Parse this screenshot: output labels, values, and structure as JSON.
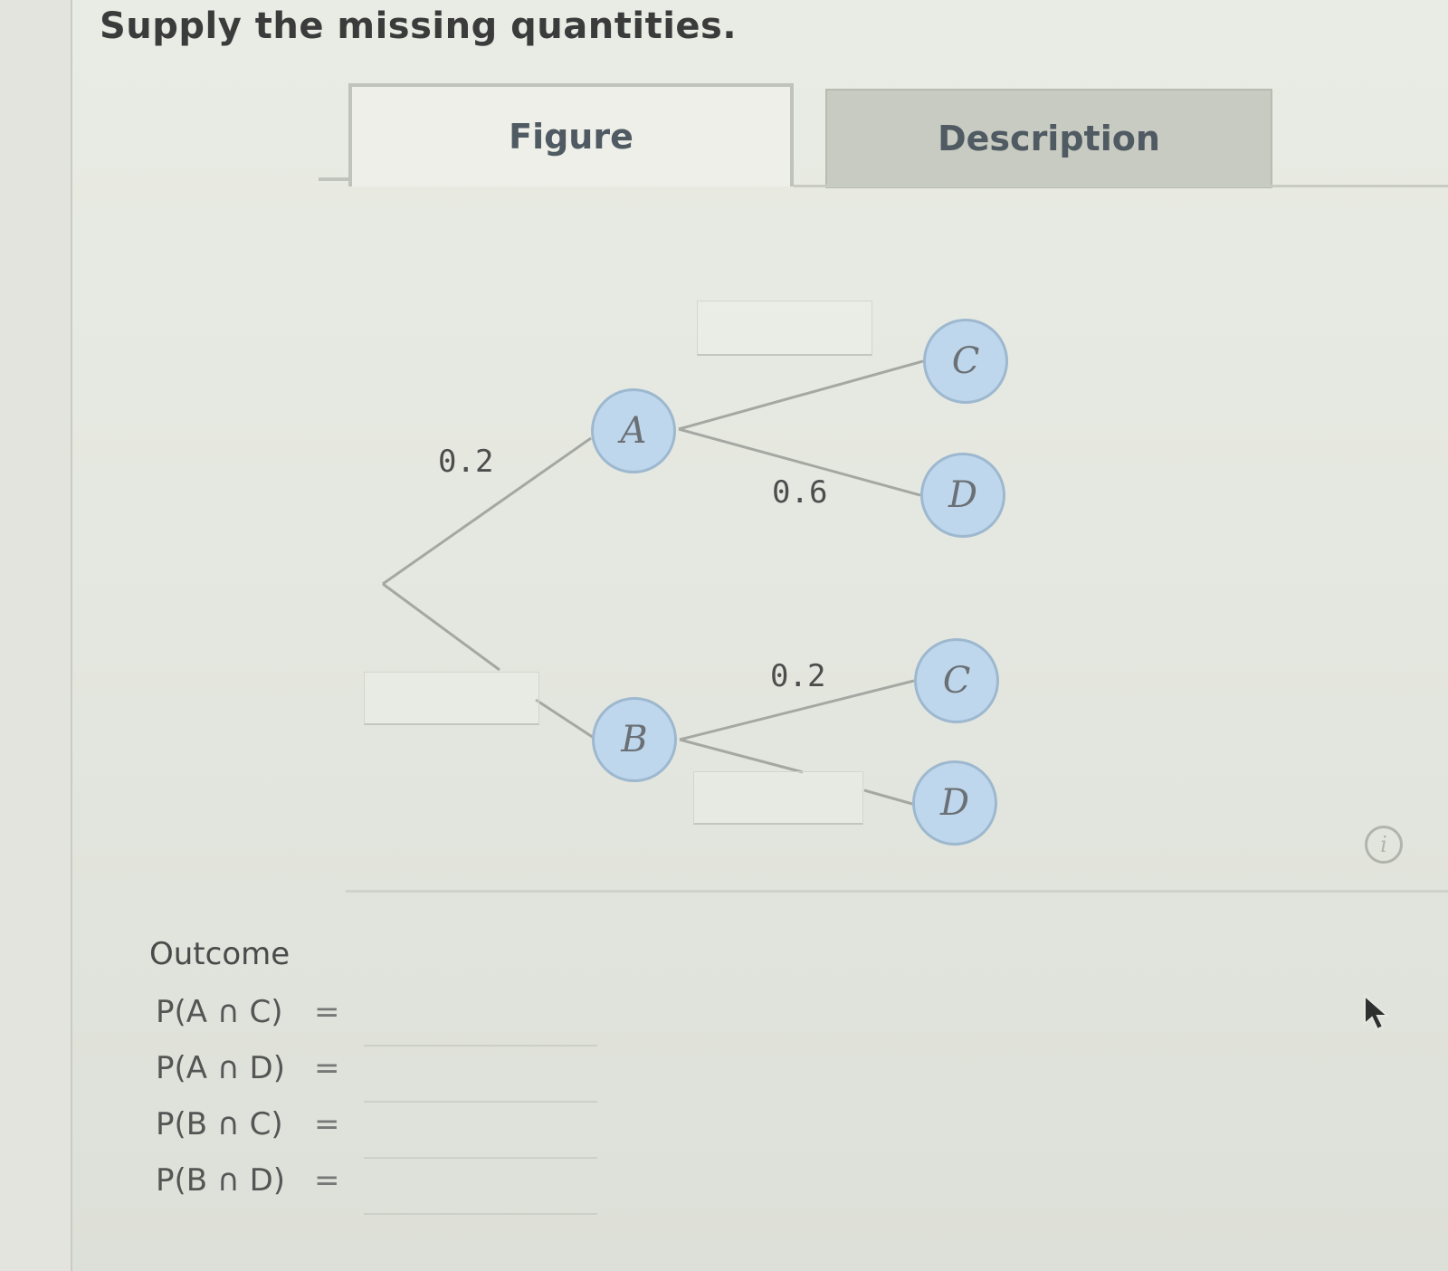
{
  "title": "Supply the missing quantities.",
  "tabs": [
    {
      "label": "Figure",
      "active": true
    },
    {
      "label": "Description",
      "active": false
    }
  ],
  "tree": {
    "branch_probabilities": {
      "A": "0.2",
      "A_D": "0.6",
      "B_C": "0.2"
    },
    "nodes": {
      "A": "A",
      "B": "B",
      "A_C": "C",
      "A_D": "D",
      "B_C": "C",
      "B_D": "D"
    }
  },
  "outcome": {
    "heading": "Outcome",
    "equals": "=",
    "rows": [
      {
        "label": "P(A ∩ C)"
      },
      {
        "label": "P(A ∩ D)"
      },
      {
        "label": "P(B ∩ C)"
      },
      {
        "label": "P(B ∩ D)"
      }
    ]
  },
  "colors": {
    "node_fill": "#bfd7ec",
    "node_border": "#9db8cf",
    "branch_line": "#a5a8a2"
  },
  "icons": {
    "info": "info-icon",
    "cursor": "mouse-pointer-icon"
  }
}
